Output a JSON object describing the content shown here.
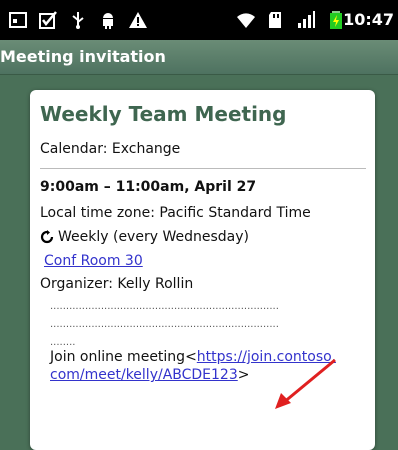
{
  "status_bar": {
    "time": "10:47",
    "left_icons": [
      "notification-icon",
      "checkbox-icon",
      "usb-icon",
      "android-icon",
      "warning-icon"
    ],
    "right_icons": [
      "wifi-icon",
      "sd-card-icon",
      "signal-icon",
      "battery-icon"
    ]
  },
  "title_bar": {
    "title": "Meeting invitation"
  },
  "meeting": {
    "title": "Weekly Team Meeting",
    "calendar": "Calendar:  Exchange",
    "time": "9:00am – 11:00am, April 27",
    "timezone": "Local time zone:  Pacific Standard Time",
    "recurrence": "Weekly (every Wednesday)",
    "room": "Conf Room 30",
    "organizer": "Organizer:  Kelly Rollin",
    "dots_1": "........................................................................",
    "dots_2": "........................................................................",
    "dots_3": "........",
    "join_text": "Join online meeting<",
    "join_link_part1": "https://join.contoso.",
    "join_link_part2": "com/meet/kelly/ABCDE123",
    "join_suffix": ">"
  },
  "colors": {
    "background": "#4a7058",
    "title_green": "#3f6650",
    "link_blue": "#3333cc",
    "arrow_red": "#e02020"
  }
}
